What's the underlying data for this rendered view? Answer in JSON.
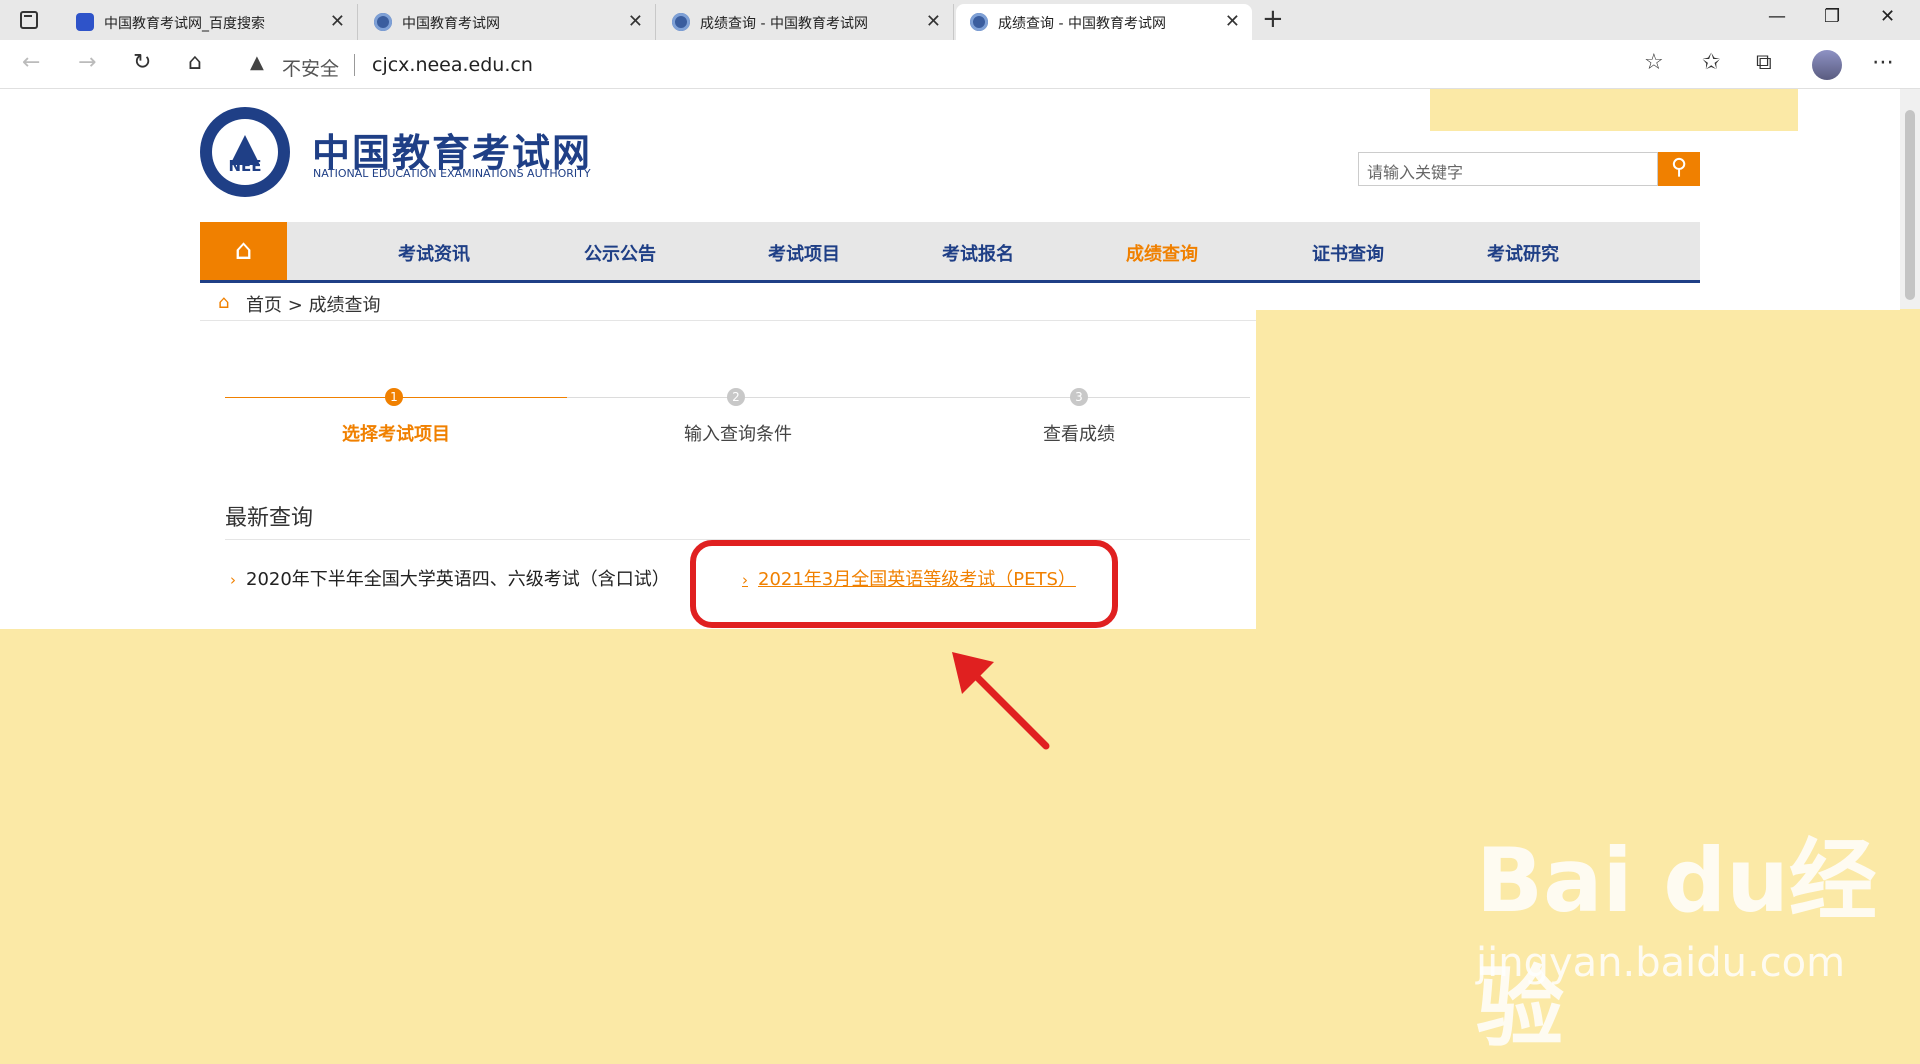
{
  "browser": {
    "tabs": [
      {
        "title": "中国教育考试网_百度搜索"
      },
      {
        "title": "中国教育考试网"
      },
      {
        "title": "成绩查询 - 中国教育考试网"
      },
      {
        "title": "成绩查询 - 中国教育考试网"
      }
    ],
    "security_label": "不安全",
    "url": "cjcx.neea.edu.cn"
  },
  "site": {
    "logo_text": "NEE",
    "title": "中国教育考试网",
    "subtitle": "NATIONAL EDUCATION EXAMINATIONS AUTHORITY",
    "search_placeholder": "请输入关键字"
  },
  "nav": {
    "items": [
      {
        "label": "考试资讯"
      },
      {
        "label": "公示公告"
      },
      {
        "label": "考试项目"
      },
      {
        "label": "考试报名"
      },
      {
        "label": "成绩查询"
      },
      {
        "label": "证书查询"
      },
      {
        "label": "考试研究"
      }
    ],
    "active_item": "成绩查询"
  },
  "breadcrumb": {
    "home": "首页",
    "separator": ">",
    "current": "成绩查询"
  },
  "steps": [
    {
      "number": "1",
      "label": "选择考试项目",
      "active": true
    },
    {
      "number": "2",
      "label": "输入查询条件",
      "active": false
    },
    {
      "number": "3",
      "label": "查看成绩",
      "active": false
    }
  ],
  "latest": {
    "title": "最新查询",
    "items": [
      {
        "label": "2020年下半年全国大学英语四、六级考试（含口试）"
      },
      {
        "label": "2021年3月全国英语等级考试（PETS）"
      }
    ]
  },
  "watermark": {
    "brand": "Bai du经验",
    "url": "jingyan.baidu.com"
  },
  "colors": {
    "brand_blue": "#1f3f86",
    "accent_orange": "#f08000",
    "highlight_yellow": "#fbe9a6",
    "annotation_red": "#e02020"
  }
}
